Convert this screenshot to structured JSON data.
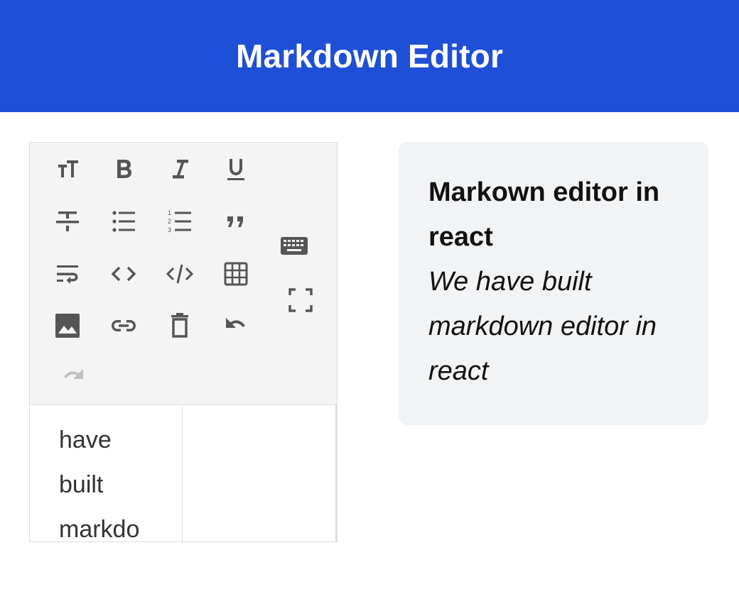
{
  "app": {
    "title": "Markdown Editor"
  },
  "colors": {
    "header": "#1f4fd6",
    "icon": "#555555",
    "icon_disabled": "#bbbbbb",
    "toolbar_bg": "#f4f4f4",
    "preview_bg": "#f2f3f5"
  },
  "toolbar": {
    "buttons": [
      {
        "icon": "text-size-icon"
      },
      {
        "icon": "bold-icon"
      },
      {
        "icon": "italic-icon"
      },
      {
        "icon": "underline-icon"
      },
      {
        "icon": "strikethrough-icon"
      },
      {
        "icon": "bulleted-list-icon"
      },
      {
        "icon": "numbered-list-icon"
      },
      {
        "icon": "blockquote-icon"
      },
      {
        "icon": "wrap-text-icon"
      },
      {
        "icon": "inline-code-icon"
      },
      {
        "icon": "code-block-icon"
      },
      {
        "icon": "table-icon"
      },
      {
        "icon": "image-icon"
      },
      {
        "icon": "link-icon"
      },
      {
        "icon": "clear-icon"
      },
      {
        "icon": "undo-icon"
      },
      {
        "icon": "redo-icon",
        "disabled": true
      },
      {
        "icon": "keyboard-icon"
      },
      {
        "icon": "fullscreen-icon"
      }
    ]
  },
  "editor": {
    "source_text": "have\nbuilt\nmarkdo"
  },
  "preview": {
    "title": "Markown editor in react",
    "body": "We have built markdown editor in react"
  }
}
